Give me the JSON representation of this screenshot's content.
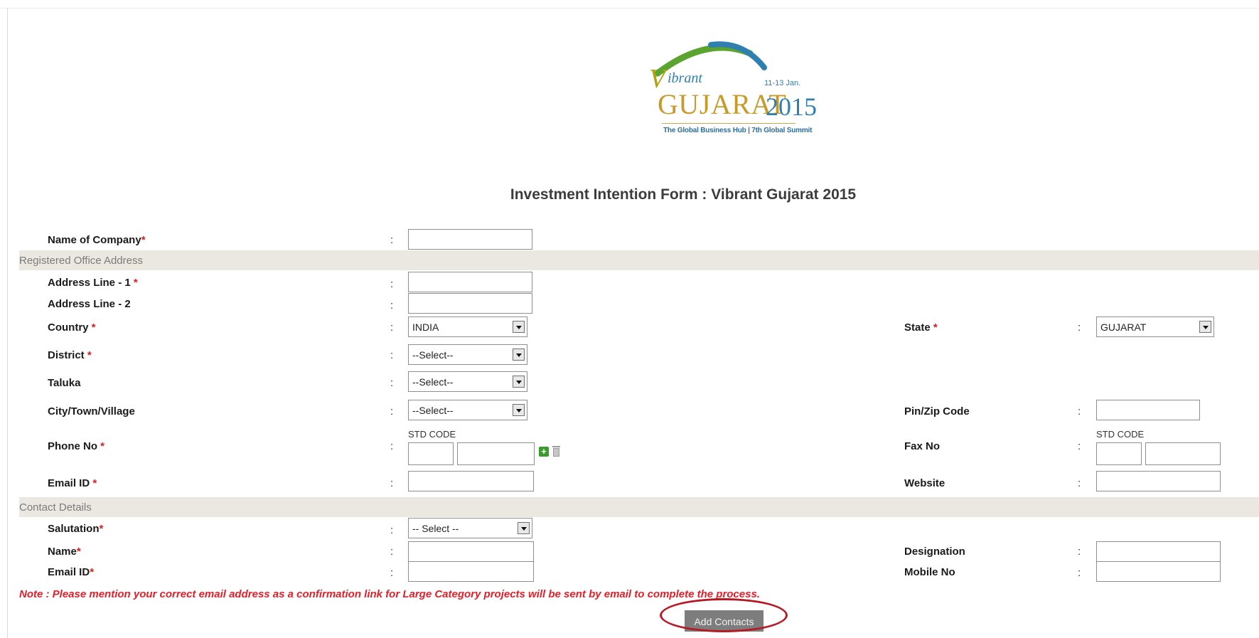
{
  "logo": {
    "vibrant": "ibrant",
    "dates": "11-13 Jan.",
    "gujarat": "GUJARAT",
    "year": "2015",
    "tagline": "The Global Business Hub | 7th Global Summit",
    "colors": {
      "gold": "#c79a2a",
      "blue": "#2f7fb1"
    }
  },
  "form": {
    "title": "Investment Intention Form : Vibrant Gujarat 2015",
    "colon": ":",
    "required_mark": "*",
    "std_code": "STD CODE",
    "company": {
      "label": "Name of Company",
      "value": ""
    },
    "sections": {
      "registered_office": "Registered Office Address",
      "contact_details": "Contact Details"
    },
    "address_line_1": {
      "label": "Address Line - 1",
      "value": ""
    },
    "address_line_2": {
      "label": "Address Line - 2",
      "value": ""
    },
    "country": {
      "label": "Country",
      "value": "INDIA"
    },
    "state": {
      "label": "State",
      "value": "GUJARAT"
    },
    "district": {
      "label": "District",
      "value": "--Select--"
    },
    "taluka": {
      "label": "Taluka",
      "value": "--Select--"
    },
    "city": {
      "label": "City/Town/Village",
      "value": "--Select--"
    },
    "pin": {
      "label": "Pin/Zip Code",
      "value": ""
    },
    "phone": {
      "label": "Phone No",
      "std_value": "",
      "number_value": ""
    },
    "fax": {
      "label": "Fax No",
      "std_value": "",
      "number_value": ""
    },
    "email": {
      "label": "Email ID",
      "value": ""
    },
    "website": {
      "label": "Website",
      "value": ""
    },
    "salutation": {
      "label": "Salutation",
      "value": "-- Select --"
    },
    "contact_name": {
      "label": "Name",
      "value": ""
    },
    "designation": {
      "label": "Designation",
      "value": ""
    },
    "contact_email": {
      "label": "Email ID",
      "value": ""
    },
    "mobile": {
      "label": "Mobile No",
      "value": ""
    },
    "note": "Note : Please mention your correct email address as a confirmation link for Large Category projects will be sent by email to complete the process.",
    "add_contacts_button": "Add Contacts"
  },
  "accent_colors": {
    "required": "#e21a1a",
    "note": "#e3202a",
    "highlight": "#b51a25",
    "section_bar": "#ebe8e1"
  }
}
